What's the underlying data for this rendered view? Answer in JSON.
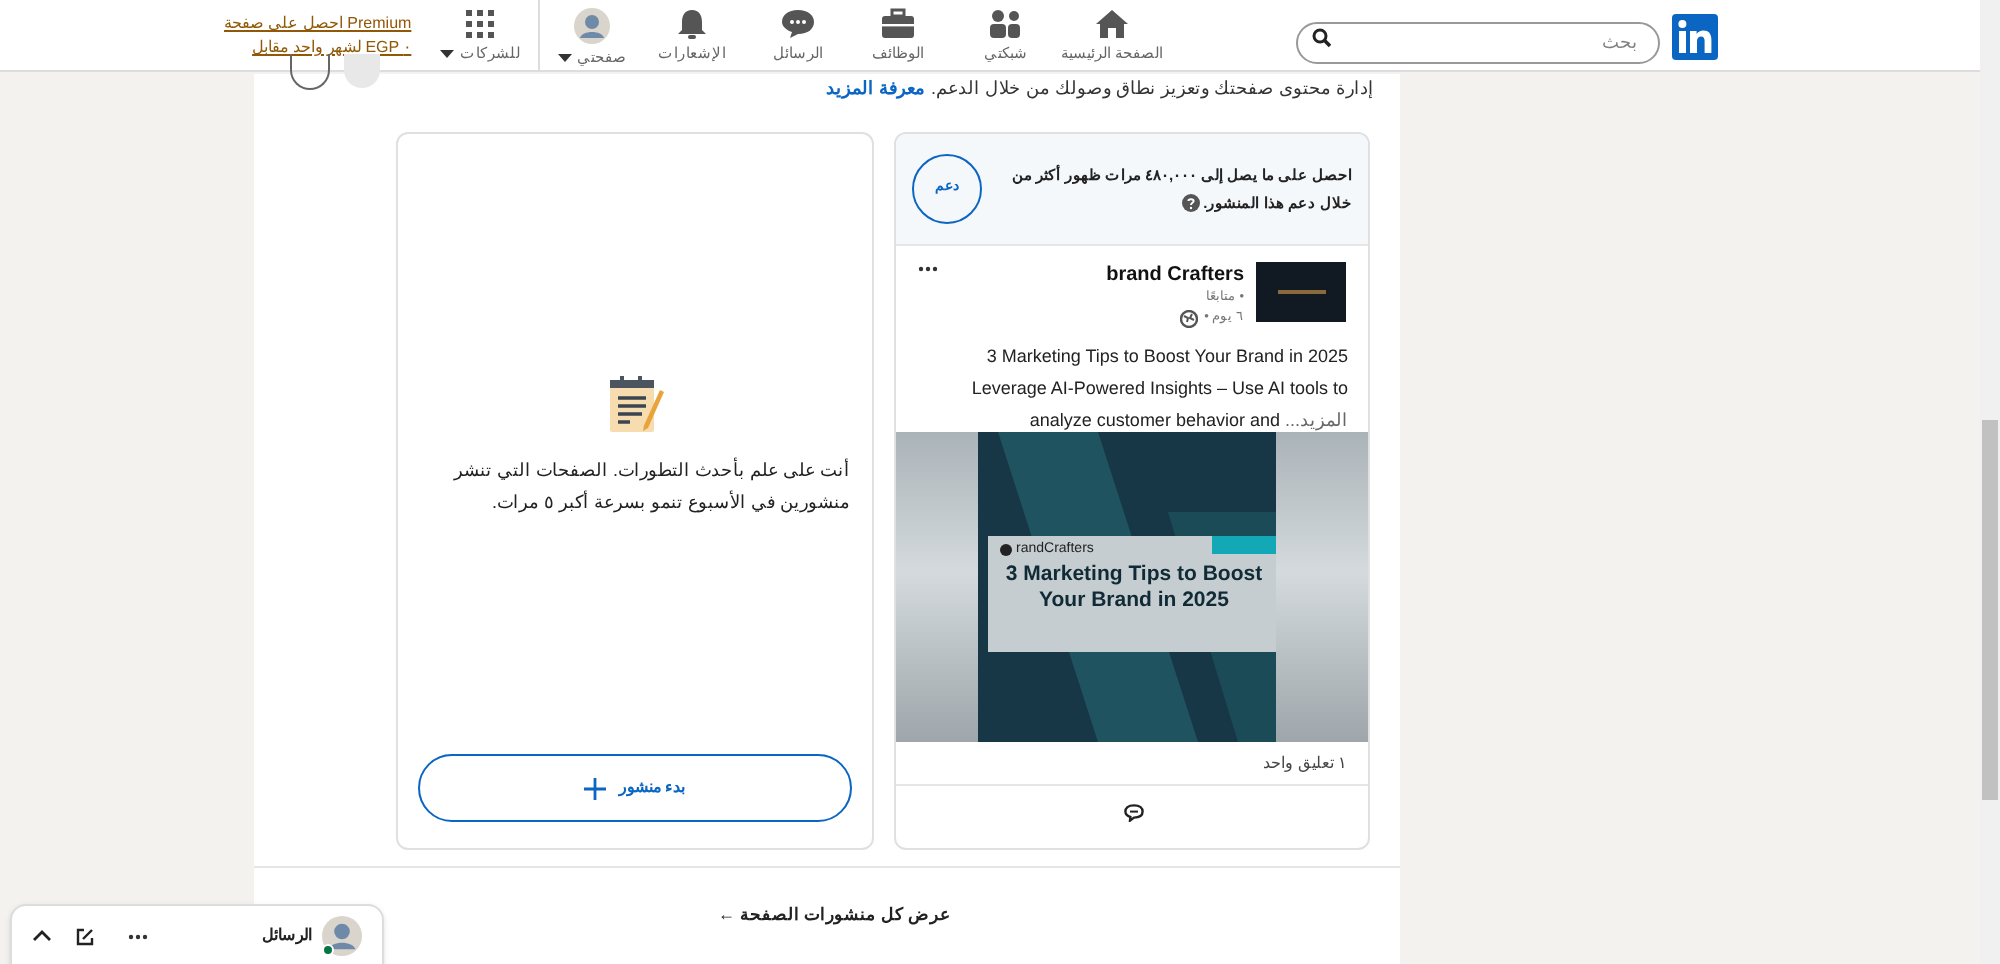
{
  "header": {
    "search": {
      "placeholder": "بحث"
    },
    "nav_items": [
      {
        "kind": "home",
        "label": "الصفحة الرئيسية",
        "has_menu": false
      },
      {
        "kind": "network",
        "label": "شبكتي",
        "has_menu": false
      },
      {
        "kind": "jobs",
        "label": "الوظائف",
        "has_menu": false
      },
      {
        "kind": "messaging",
        "label": "الرسائل",
        "has_menu": false
      },
      {
        "kind": "notifications",
        "label": "الإشعارات",
        "has_menu": false
      },
      {
        "kind": "me",
        "label": "صفحتي",
        "has_menu": true
      },
      {
        "kind": "apps",
        "label": "للشركات",
        "has_menu": true
      }
    ],
    "premium_link": [
      "احصل على صفحة Premium",
      "لشهر واحد مقابل EGP ٠"
    ]
  },
  "intro": {
    "text": "إدارة محتوى صفحتك وتعزيز نطاق وصولك من خلال الدعم.",
    "link": "معرفة المزيد"
  },
  "post_card": {
    "boost_text": "احصل على ما يصل إلى ٤٨٠,٠٠٠ مرات ظهور أكثر من خلال دعم هذا المنشور.",
    "boost_button": "دعم",
    "author": "brand Crafters",
    "followers": "• متابعًا",
    "time": "٦ يوم •",
    "body": "3 Marketing Tips to Boost Your Brand in 2025 Leverage AI-Powered Insights – Use AI tools to analyze customer behavior and",
    "more_link": "...المزيد",
    "image": {
      "brand": "randCrafters",
      "title": "3 Marketing Tips to Boost Your Brand in 2025"
    },
    "comments": "١ تعليق واحد"
  },
  "empty_card": {
    "text": "أنت على علم بأحدث التطورات. الصفحات التي تنشر منشورين في الأسبوع تنمو بسرعة أكبر ٥ مرات.",
    "button": "بدء منشور"
  },
  "show_all_link": "عرض كل منشورات الصفحة ←",
  "messaging_bar": {
    "title": "الرسائل",
    "online": true
  }
}
